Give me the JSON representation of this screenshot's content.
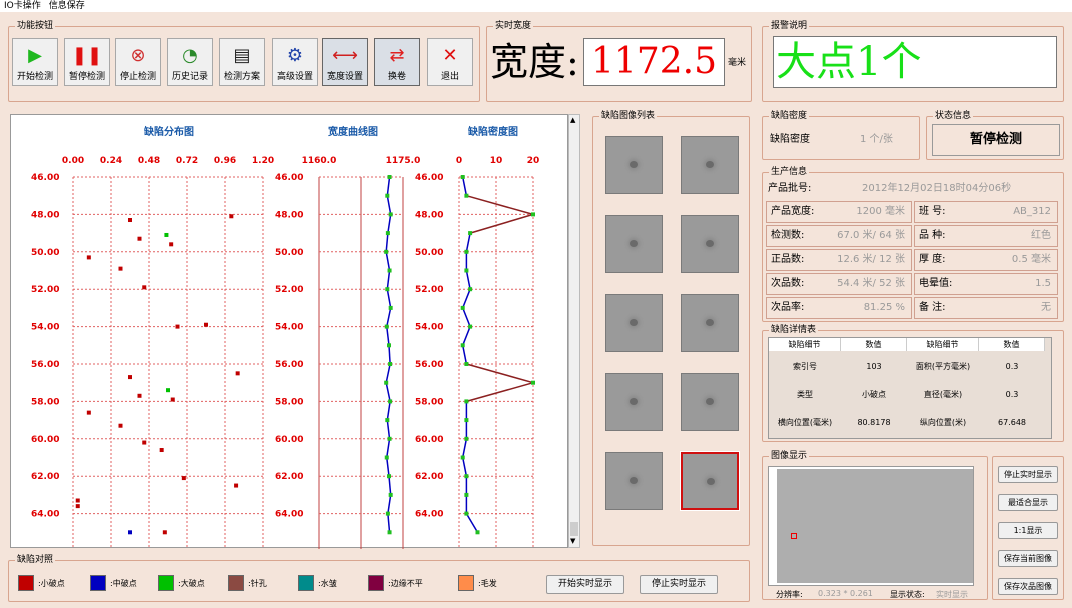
{
  "menu": [
    "IO卡操作",
    "信息保存"
  ],
  "groups": {
    "func": "功能按钮",
    "width": "实时宽度",
    "alarm": "报警说明",
    "gallery": "缺陷图像列表",
    "density": "缺陷密度",
    "status": "状态信息",
    "prod": "生产信息",
    "detail": "缺陷详情表",
    "image": "图像显示",
    "legend": "缺陷对照"
  },
  "toolbar": [
    {
      "label": "开始检测",
      "icon": "play-icon",
      "color": "#1fb81f"
    },
    {
      "label": "暂停检测",
      "icon": "pause-icon",
      "color": "#e01010"
    },
    {
      "label": "停止检测",
      "icon": "stop-icon",
      "color": "#d03030"
    },
    {
      "label": "历史记录",
      "icon": "history-icon",
      "color": "#2a8a2a"
    },
    {
      "label": "检测方案",
      "icon": "document-icon",
      "color": "#222222"
    },
    {
      "label": "高级设置",
      "icon": "settings-icon",
      "color": "#2244aa"
    },
    {
      "label": "宽度设置",
      "icon": "ruler-icon",
      "color": "#d02020"
    },
    {
      "label": "换卷",
      "icon": "exchange-icon",
      "color": "#e02020"
    },
    {
      "label": "退出",
      "icon": "exit-icon",
      "color": "#e01010"
    }
  ],
  "width": {
    "label": "宽度:",
    "value": "1172.5",
    "unit": "毫米"
  },
  "alarm": {
    "text": "大点1个"
  },
  "density": {
    "label": "缺陷密度",
    "value": "1 个/张"
  },
  "status": {
    "value": "暂停检测"
  },
  "prod": {
    "batch_label": "产品批号:",
    "batch_value": "2012年12月02日18时04分06秒",
    "rows": [
      [
        {
          "l": "产品宽度:",
          "v": "1200 毫米"
        },
        {
          "l": "班  号:",
          "v": "AB_312"
        }
      ],
      [
        {
          "l": "检测数:",
          "v": "67.0 米/    64 张"
        },
        {
          "l": "品  种:",
          "v": "红色"
        }
      ],
      [
        {
          "l": "正品数:",
          "v": "12.6 米/    12 张"
        },
        {
          "l": "厚  度:",
          "v": "0.5 毫米"
        }
      ],
      [
        {
          "l": "次品数:",
          "v": "54.4 米/    52 张"
        },
        {
          "l": "电晕值:",
          "v": "1.5"
        }
      ],
      [
        {
          "l": "次品率:",
          "v": "81.25 %"
        },
        {
          "l": "备  注:",
          "v": "无"
        }
      ]
    ]
  },
  "detail": {
    "headers": [
      "缺陷细节",
      "数值",
      "缺陷细节",
      "数值"
    ],
    "rows": [
      [
        "索引号",
        "103",
        "面积(平方毫米)",
        "0.3"
      ],
      [
        "类型",
        "小破点",
        "直径(毫米)",
        "0.3"
      ],
      [
        "横向位置(毫米)",
        "80.8178",
        "纵向位置(米)",
        "67.648"
      ]
    ]
  },
  "image": {
    "res_label": "分辨率:",
    "res_value": "0.323 * 0.261",
    "disp_label": "显示状态:",
    "disp_value": "实时显示"
  },
  "rightbtns": [
    "停止实时显示",
    "最适合显示",
    "1:1显示",
    "保存当前图像",
    "保存次品图像"
  ],
  "legend": [
    {
      "label": "小破点",
      "color": "#c00000"
    },
    {
      "label": "中破点",
      "color": "#0000c0"
    },
    {
      "label": "大破点",
      "color": "#00c000"
    },
    {
      "label": "针孔",
      "color": "#8b4a42"
    },
    {
      "label": "水皱",
      "color": "#008b8b"
    },
    {
      "label": "边缘不平",
      "color": "#800040"
    },
    {
      "label": "毛发",
      "color": "#ff8c4a"
    }
  ],
  "bottombtns": [
    "开始实时显示",
    "停止实时显示"
  ],
  "chart_data": [
    {
      "type": "scatter",
      "title": "缺陷分布图",
      "xlim": [
        0,
        1.2
      ],
      "x_ticks": [
        "0.00",
        "0.24",
        "0.48",
        "0.72",
        "0.96",
        "1.20"
      ],
      "ylim": [
        46,
        65
      ],
      "y_ticks": [
        "46.00",
        "48.00",
        "50.00",
        "52.00",
        "54.00",
        "56.00",
        "58.00",
        "60.00",
        "62.00",
        "64.00"
      ],
      "series": [
        {
          "name": "小破点",
          "color": "#c00000",
          "points": [
            [
              0.36,
              48.3
            ],
            [
              1.0,
              48.1
            ],
            [
              0.42,
              49.3
            ],
            [
              0.62,
              49.6
            ],
            [
              0.1,
              50.3
            ],
            [
              0.3,
              50.9
            ],
            [
              0.45,
              51.9
            ],
            [
              0.66,
              54.0
            ],
            [
              0.84,
              53.9
            ],
            [
              1.04,
              56.5
            ],
            [
              0.36,
              56.7
            ],
            [
              0.42,
              57.7
            ],
            [
              0.63,
              57.9
            ],
            [
              0.1,
              58.6
            ],
            [
              0.3,
              59.3
            ],
            [
              0.45,
              60.2
            ],
            [
              0.56,
              60.6
            ],
            [
              0.7,
              62.1
            ],
            [
              1.03,
              62.5
            ],
            [
              0.03,
              63.3
            ],
            [
              0.03,
              63.6
            ],
            [
              0.58,
              65.0
            ]
          ]
        },
        {
          "name": "中破点",
          "color": "#0000c0",
          "points": [
            [
              0.36,
              65.0
            ]
          ]
        },
        {
          "name": "大破点",
          "color": "#00c000",
          "points": [
            [
              0.59,
              49.1
            ],
            [
              0.6,
              57.4
            ]
          ]
        }
      ]
    },
    {
      "type": "line",
      "title": "宽度曲线图",
      "x_ticks": [
        "1160.0",
        "1175.0"
      ],
      "xlim": [
        1160,
        1175
      ],
      "ylim": [
        46,
        65
      ],
      "y_ticks": [
        "46.00",
        "48.00",
        "50.00",
        "52.00",
        "54.00",
        "56.00",
        "58.00",
        "60.00",
        "62.00",
        "64.00"
      ],
      "x": [
        46,
        47,
        48,
        49,
        50,
        51,
        52,
        53,
        54,
        55,
        56,
        57,
        58,
        59,
        60,
        61,
        62,
        63,
        64,
        65
      ],
      "values": [
        1172.6,
        1172.2,
        1172.8,
        1172.3,
        1172.0,
        1172.6,
        1172.2,
        1172.8,
        1172.1,
        1172.5,
        1172.7,
        1172.0,
        1172.7,
        1172.2,
        1172.6,
        1172.1,
        1172.5,
        1172.8,
        1172.3,
        1172.6
      ]
    },
    {
      "type": "line",
      "title": "缺陷密度图",
      "x_ticks": [
        "0",
        "10",
        "20"
      ],
      "xlim": [
        0,
        20
      ],
      "ylim": [
        46,
        65
      ],
      "y_ticks": [
        "46.00",
        "48.00",
        "50.00",
        "52.00",
        "54.00",
        "56.00",
        "58.00",
        "60.00",
        "62.00",
        "64.00"
      ],
      "x": [
        46,
        47,
        48,
        49,
        50,
        51,
        52,
        53,
        54,
        55,
        56,
        57,
        58,
        59,
        60,
        61,
        62,
        63,
        64,
        65
      ],
      "values": [
        1,
        2,
        20,
        3,
        2,
        2,
        3,
        1,
        3,
        1,
        2,
        20,
        2,
        2,
        2,
        1,
        2,
        2,
        2,
        5
      ]
    }
  ]
}
